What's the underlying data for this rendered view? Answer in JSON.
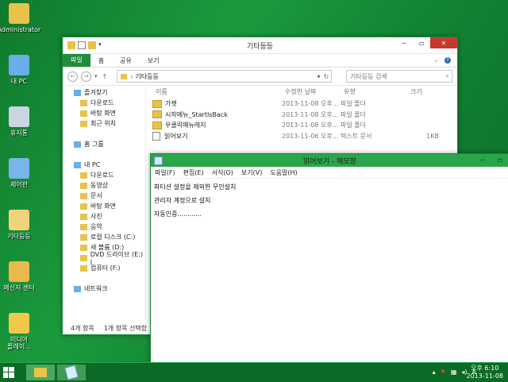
{
  "desktop": {
    "icons": [
      {
        "label": "Administrator",
        "icon": "user-folder-icon"
      },
      {
        "label": "내 PC",
        "icon": "computer-icon"
      },
      {
        "label": "휴지통",
        "icon": "recycle-bin-icon"
      },
      {
        "label": "제어판",
        "icon": "control-panel-icon"
      },
      {
        "label": "기타등등",
        "icon": "folder-icon"
      },
      {
        "label": "메신저 센터",
        "icon": "messenger-icon"
      },
      {
        "label": "미디어\n플레이...",
        "icon": "media-player-icon"
      }
    ]
  },
  "explorer": {
    "title": "기타등등",
    "ribbon_tabs": [
      "파일",
      "홈",
      "공유",
      "보기"
    ],
    "address": "기타등등",
    "search_placeholder": "기타등등 검색",
    "nav": [
      {
        "label": "즐겨찾기",
        "indent": 0
      },
      {
        "label": "다운로드",
        "indent": 1
      },
      {
        "label": "바탕 화면",
        "indent": 1
      },
      {
        "label": "최근 위치",
        "indent": 1
      },
      {
        "label": "",
        "indent": 0
      },
      {
        "label": "홈 그룹",
        "indent": 0
      },
      {
        "label": "",
        "indent": 0
      },
      {
        "label": "내 PC",
        "indent": 0
      },
      {
        "label": "다운로드",
        "indent": 1
      },
      {
        "label": "동영상",
        "indent": 1
      },
      {
        "label": "문서",
        "indent": 1
      },
      {
        "label": "바탕 화면",
        "indent": 1
      },
      {
        "label": "사진",
        "indent": 1
      },
      {
        "label": "음악",
        "indent": 1
      },
      {
        "label": "로컬 디스크 (C:)",
        "indent": 1
      },
      {
        "label": "새 볼륨 (D:)",
        "indent": 1
      },
      {
        "label": "DVD 드라이브 (E:) I",
        "indent": 1
      },
      {
        "label": "컴퓨터 (F:)",
        "indent": 1
      },
      {
        "label": "",
        "indent": 0
      },
      {
        "label": "네트워크",
        "indent": 0
      }
    ],
    "columns": [
      "이름",
      "수정한 날짜",
      "유형",
      "크기"
    ],
    "files": [
      {
        "name": "가젯",
        "date": "2013-11-08 오후...",
        "type": "파일 폴더",
        "size": "",
        "kind": "folder"
      },
      {
        "name": "시작메뉴_StartIsBack",
        "date": "2013-11-08 오후...",
        "type": "파일 폴더",
        "size": "",
        "kind": "folder"
      },
      {
        "name": "우클릭메뉴레지",
        "date": "2013-11-08 오후...",
        "type": "파일 폴더",
        "size": "",
        "kind": "folder"
      },
      {
        "name": "읽어보기",
        "date": "2013-11-06 오후...",
        "type": "텍스트 문서",
        "size": "1KB",
        "kind": "text"
      }
    ],
    "status": [
      "4개 항목",
      "1개 항목 선택함"
    ]
  },
  "notepad": {
    "title": "읽어보기 - 메모장",
    "menu": [
      "파일(F)",
      "편집(E)",
      "서식(O)",
      "보기(V)",
      "도움말(H)"
    ],
    "lines": [
      "파티션 설정을 제외한 무인설치",
      "관리자 계정으로 설치",
      "자동인증............"
    ]
  },
  "taskbar": {
    "time": "오후 6:10",
    "date": "2013-11-08",
    "tray_ime": "A"
  },
  "colors": {
    "accent": "#1e8e3a",
    "close": "#c7392f",
    "desktop": "#138434"
  }
}
